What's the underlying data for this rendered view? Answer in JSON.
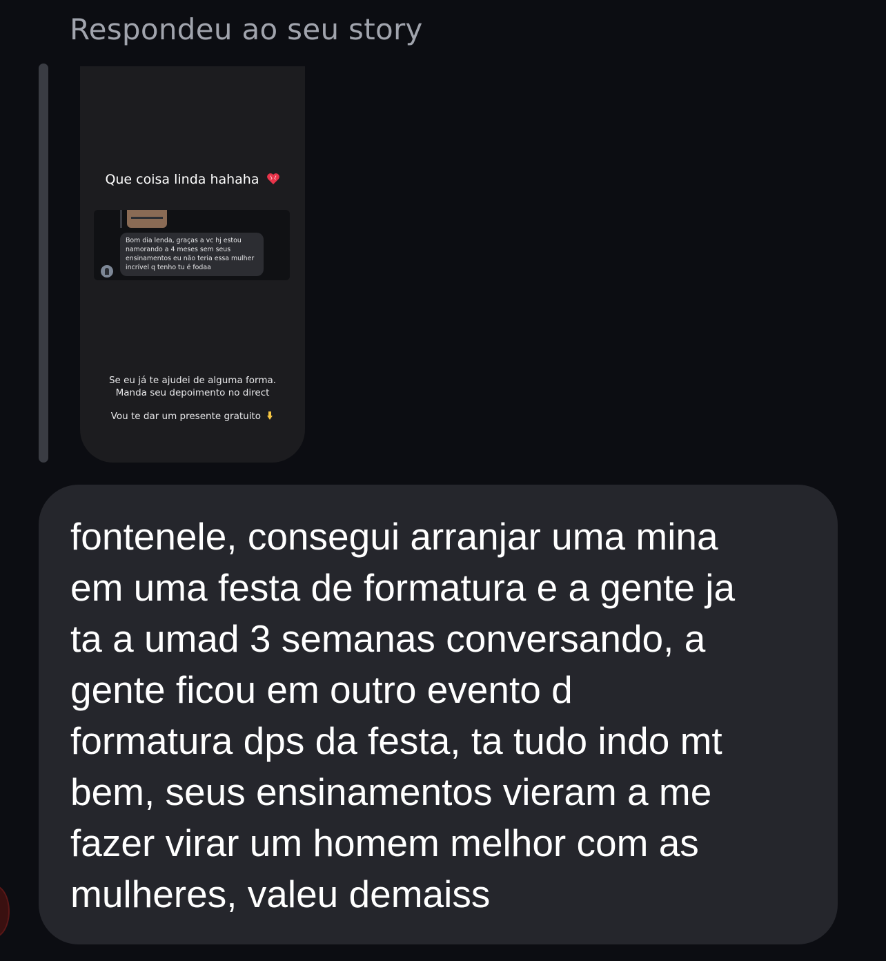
{
  "reply_header": "Respondeu ao seu story",
  "story": {
    "caption": "Que coisa linda hahaha",
    "inner_message": "Bom dia lenda, graças a vc hj estou namorando a 4 meses sem seus ensinamentos eu não teria essa mulher incrível q tenho tu é fodaa",
    "footer_line1": "Se eu já te ajudei de alguma forma.",
    "footer_line2": "Manda seu depoimento no direct",
    "footer_line3": "Vou te dar um presente gratuito"
  },
  "message": {
    "text": "fontenele, consegui arranjar uma mina\nem uma festa de formatura e a gente ja\nta a umad 3 semanas conversando, a\ngente ficou em outro evento d\nformatura dps da festa, ta tudo indo mt\nbem, seus ensinamentos vieram a me\nfazer virar um homem melhor com as\nmulheres, valeu demaiss"
  },
  "icons": {
    "heart": "heart-icon",
    "pointing_down": "pointing-down-icon",
    "avatar": "avatar"
  },
  "colors": {
    "background": "#0c0d12",
    "bubble": "#25262c",
    "header_text": "#a1a4ad",
    "story_card": "#1c1c1f"
  }
}
